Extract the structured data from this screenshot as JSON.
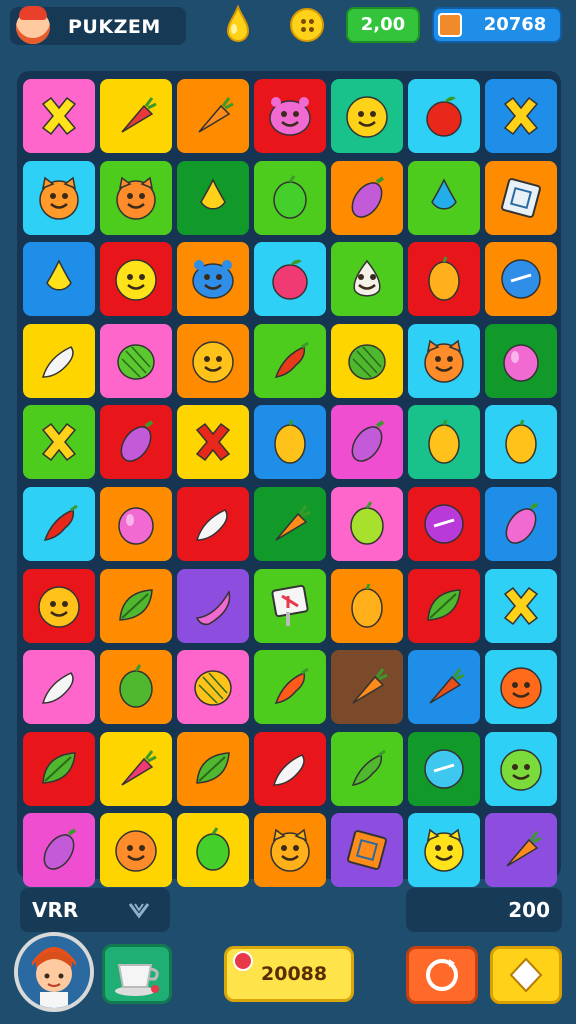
{
  "header": {
    "game_title": "PUKZEM",
    "moves_value": "2,00",
    "coins_value": "20768"
  },
  "colors": {
    "pink": "#ff66cc",
    "yellow": "#ffd500",
    "orange": "#ff8c00",
    "red": "#e8151b",
    "teal": "#19c28a",
    "cyan": "#2ed0f5",
    "blue": "#1e8ee8",
    "green": "#4ecc1e",
    "magenta": "#f04ed0",
    "purple": "#8d4ee0",
    "brown": "#7a4a2a",
    "darkgreen": "#119a2a"
  },
  "board": {
    "rows": [
      [
        {
          "bg": "pink",
          "icon": "x-mark-icon",
          "c": "#ffe21a"
        },
        {
          "bg": "yellow",
          "icon": "carrot-icon",
          "c": "#e8393a"
        },
        {
          "bg": "orange",
          "icon": "carrot-icon",
          "c": "#ff8c1a"
        },
        {
          "bg": "red",
          "icon": "monster-face-icon",
          "c": "#f06ad2"
        },
        {
          "bg": "teal",
          "icon": "smiley-face-icon",
          "c": "#ffd21a"
        },
        {
          "bg": "cyan",
          "icon": "apple-icon",
          "c": "#e8281b"
        },
        {
          "bg": "blue",
          "icon": "x-mark-icon",
          "c": "#ffd21a"
        }
      ],
      [
        {
          "bg": "cyan",
          "icon": "cat-face-icon",
          "c": "#ff9a2b"
        },
        {
          "bg": "green",
          "icon": "cat-face-icon",
          "c": "#ff8c2b"
        },
        {
          "bg": "darkgreen",
          "icon": "pear-icon",
          "c": "#ffd21a"
        },
        {
          "bg": "green",
          "icon": "lime-icon",
          "c": "#44cf2b"
        },
        {
          "bg": "orange",
          "icon": "eggplant-icon",
          "c": "#c35ad8"
        },
        {
          "bg": "green",
          "icon": "pear-icon",
          "c": "#22aee8"
        },
        {
          "bg": "orange",
          "icon": "box-icon",
          "c": "#e8f0f8"
        }
      ],
      [
        {
          "bg": "blue",
          "icon": "pear-icon",
          "c": "#ffe21a"
        },
        {
          "bg": "red",
          "icon": "smiley-face-icon",
          "c": "#ffe21a"
        },
        {
          "bg": "orange",
          "icon": "monster-face-icon",
          "c": "#2f8ee8"
        },
        {
          "bg": "cyan",
          "icon": "apple-icon",
          "c": "#ef3a74"
        },
        {
          "bg": "green",
          "icon": "onion-icon",
          "c": "#f3f0e8"
        },
        {
          "bg": "red",
          "icon": "lemon-icon",
          "c": "#ffb01a"
        },
        {
          "bg": "orange",
          "icon": "orb-icon",
          "c": "#2e8ee8"
        }
      ],
      [
        {
          "bg": "yellow",
          "icon": "radish-icon",
          "c": "#f5f5f5"
        },
        {
          "bg": "pink",
          "icon": "melon-icon",
          "c": "#5ac82e"
        },
        {
          "bg": "orange",
          "icon": "smiley-face-icon",
          "c": "#ffc21a"
        },
        {
          "bg": "green",
          "icon": "chili-icon",
          "c": "#e8391b"
        },
        {
          "bg": "yellow",
          "icon": "melon-icon",
          "c": "#4fb82e"
        },
        {
          "bg": "cyan",
          "icon": "cat-face-icon",
          "c": "#ff8c2b"
        },
        {
          "bg": "darkgreen",
          "icon": "plum-icon",
          "c": "#f06ad2"
        }
      ],
      [
        {
          "bg": "green",
          "icon": "x-mark-icon",
          "c": "#ffd21a"
        },
        {
          "bg": "red",
          "icon": "eggplant-icon",
          "c": "#c35ad8"
        },
        {
          "bg": "yellow",
          "icon": "x-mark-icon",
          "c": "#e8281b"
        },
        {
          "bg": "blue",
          "icon": "lemon-icon",
          "c": "#ffc21a"
        },
        {
          "bg": "magenta",
          "icon": "eggplant-icon",
          "c": "#c35ad8"
        },
        {
          "bg": "teal",
          "icon": "lemon-icon",
          "c": "#ffc21a"
        },
        {
          "bg": "cyan",
          "icon": "lemon-icon",
          "c": "#ffc21a"
        }
      ],
      [
        {
          "bg": "cyan",
          "icon": "chili-icon",
          "c": "#e8281b"
        },
        {
          "bg": "orange",
          "icon": "plum-icon",
          "c": "#f06ad2"
        },
        {
          "bg": "red",
          "icon": "radish-icon",
          "c": "#f5f5f5"
        },
        {
          "bg": "darkgreen",
          "icon": "carrot-icon",
          "c": "#ff8c1a"
        },
        {
          "bg": "pink",
          "icon": "lime-icon",
          "c": "#a8e02e"
        },
        {
          "bg": "red",
          "icon": "orb-icon",
          "c": "#b83ad8"
        },
        {
          "bg": "blue",
          "icon": "eggplant-icon",
          "c": "#f06ad2"
        }
      ],
      [
        {
          "bg": "red",
          "icon": "smiley-face-icon",
          "c": "#ffc21a"
        },
        {
          "bg": "orange",
          "icon": "leaf-icon",
          "c": "#4fb82e"
        },
        {
          "bg": "purple",
          "icon": "banana-icon",
          "c": "#f06ad2"
        },
        {
          "bg": "green",
          "icon": "sign-icon",
          "c": "#f5f5f5"
        },
        {
          "bg": "orange",
          "icon": "lemon-icon",
          "c": "#ffb01a"
        },
        {
          "bg": "red",
          "icon": "leaf-icon",
          "c": "#4fb82e"
        },
        {
          "bg": "cyan",
          "icon": "x-mark-icon",
          "c": "#ffd21a"
        }
      ],
      [
        {
          "bg": "pink",
          "icon": "radish-icon",
          "c": "#f5f5f5"
        },
        {
          "bg": "orange",
          "icon": "lime-icon",
          "c": "#4fb82e"
        },
        {
          "bg": "pink",
          "icon": "melon-icon",
          "c": "#ffc21a"
        },
        {
          "bg": "green",
          "icon": "chili-icon",
          "c": "#ff5a1b"
        },
        {
          "bg": "brown",
          "icon": "carrot-icon",
          "c": "#ff8c1a"
        },
        {
          "bg": "blue",
          "icon": "carrot-icon",
          "c": "#e8501b"
        },
        {
          "bg": "cyan",
          "icon": "smiley-face-icon",
          "c": "#ff6a1b"
        }
      ],
      [
        {
          "bg": "red",
          "icon": "leaf-icon",
          "c": "#4fb82e"
        },
        {
          "bg": "yellow",
          "icon": "carrot-icon",
          "c": "#ef3a74"
        },
        {
          "bg": "orange",
          "icon": "leaf-icon",
          "c": "#4fb82e"
        },
        {
          "bg": "red",
          "icon": "radish-icon",
          "c": "#f5f5f5"
        },
        {
          "bg": "green",
          "icon": "chili-icon",
          "c": "#4fb82e"
        },
        {
          "bg": "darkgreen",
          "icon": "orb-icon",
          "c": "#3ec8f0"
        },
        {
          "bg": "cyan",
          "icon": "smiley-face-icon",
          "c": "#7adb3a"
        }
      ],
      [
        {
          "bg": "magenta",
          "icon": "eggplant-icon",
          "c": "#c35ad8"
        },
        {
          "bg": "yellow",
          "icon": "smiley-face-icon",
          "c": "#ff8c2b"
        },
        {
          "bg": "yellow",
          "icon": "lime-icon",
          "c": "#44cf2b"
        },
        {
          "bg": "orange",
          "icon": "cat-face-icon",
          "c": "#ffb01a"
        },
        {
          "bg": "purple",
          "icon": "box-icon",
          "c": "#ff8c1a"
        },
        {
          "bg": "cyan",
          "icon": "cat-face-icon",
          "c": "#ffe21a"
        },
        {
          "bg": "purple",
          "icon": "carrot-icon",
          "c": "#ff8c1a"
        }
      ]
    ]
  },
  "footer": {
    "mode_label": "VRR",
    "score_value": "200",
    "coins_total": "20088"
  }
}
